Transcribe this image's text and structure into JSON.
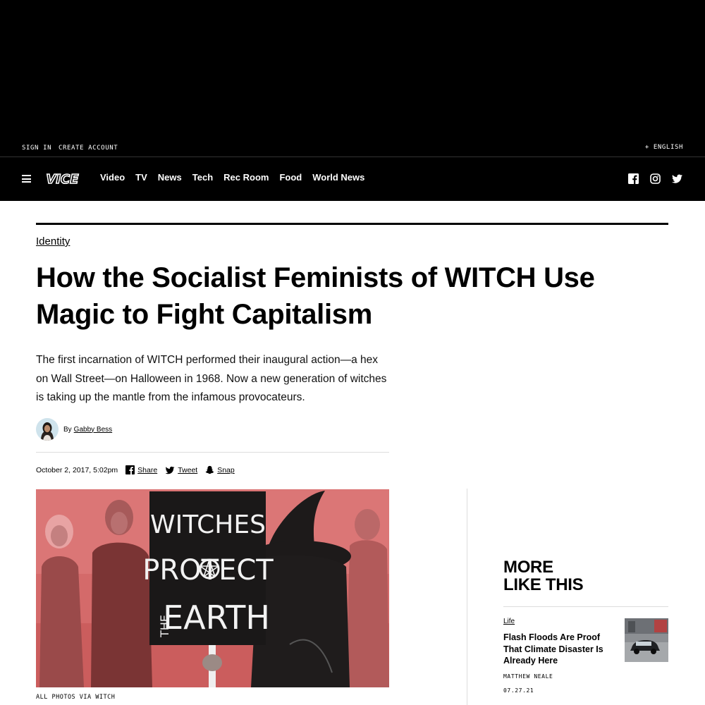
{
  "utility": {
    "sign_in": "SIGN IN",
    "create_account": "CREATE ACCOUNT",
    "language": "+ ENGLISH"
  },
  "nav": {
    "logo_text": "VICE",
    "links": [
      "Video",
      "TV",
      "News",
      "Tech",
      "Rec Room",
      "Food",
      "World News"
    ],
    "social_icons": [
      "facebook-icon",
      "instagram-icon",
      "twitter-icon"
    ]
  },
  "article": {
    "category": "Identity",
    "headline_line1": "How the Socialist Feminists of WITCH Use",
    "headline_line2": "Magic to Fight Capitalism",
    "dek": "The first incarnation of WITCH performed their inaugural action—a hex on Wall Street—on Halloween in 1968. Now a new generation of witches is taking up the mantle from the infamous provocateurs.",
    "by_prefix": "By",
    "author": "Gabby Bess",
    "date": "October 2, 2017, 5:02pm",
    "share_label": "Share",
    "tweet_label": "Tweet",
    "snap_label": "Snap",
    "hero_sign_line1": "WITCHES",
    "hero_sign_line2": "PROTECT",
    "hero_sign_line3": "EARTH",
    "hero_sign_the": "THE",
    "caption": "ALL PHOTOS VIA WITCH"
  },
  "sidebar": {
    "title_line1": "MORE",
    "title_line2": "LIKE THIS",
    "card": {
      "category": "Life",
      "title": "Flash Floods Are Proof That Climate Disaster Is Already Here",
      "author": "MATTHEW NEALE",
      "date": "07.27.21"
    }
  },
  "colors": {
    "header_bg": "#000000",
    "hero_tint": "#cf5a5a",
    "text": "#000000"
  }
}
